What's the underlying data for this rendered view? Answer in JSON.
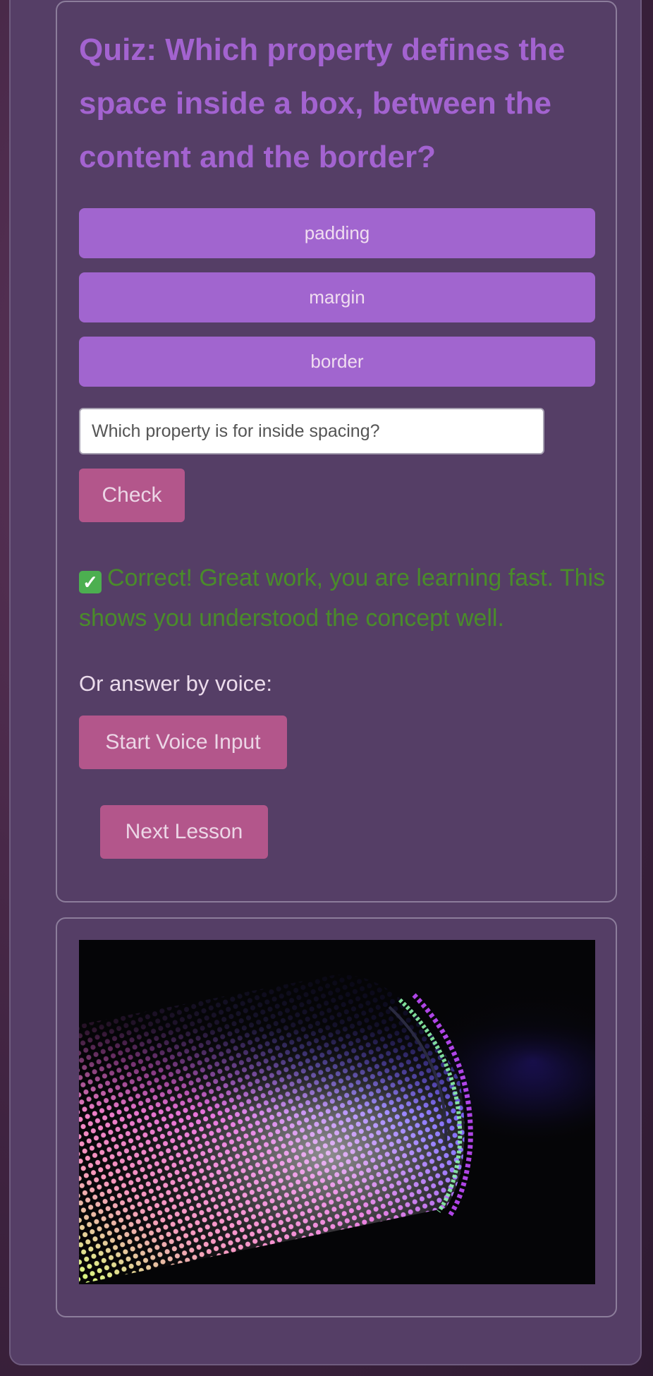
{
  "quiz": {
    "title": "Quiz: Which property defines the space inside a box, between the content and the border?",
    "options": [
      {
        "label": "padding"
      },
      {
        "label": "margin"
      },
      {
        "label": "border"
      }
    ],
    "answer_input": {
      "value": "Which property is for inside spacing?"
    },
    "check_label": "Check",
    "feedback_icon": "✅",
    "feedback_text": "Correct! Great work, you are learning fast. This shows you understood the concept well.",
    "voice_prompt": "Or answer by voice:",
    "voice_button_label": "Start Voice Input",
    "next_button_label": "Next Lesson"
  },
  "image": {
    "subject": "speaker-grille-photo"
  },
  "colors": {
    "panel_bg": "#553e66",
    "title": "#a363d0",
    "option_bg": "#a165cf",
    "action_bg": "#b3568b",
    "feedback": "#4a8c2a"
  }
}
